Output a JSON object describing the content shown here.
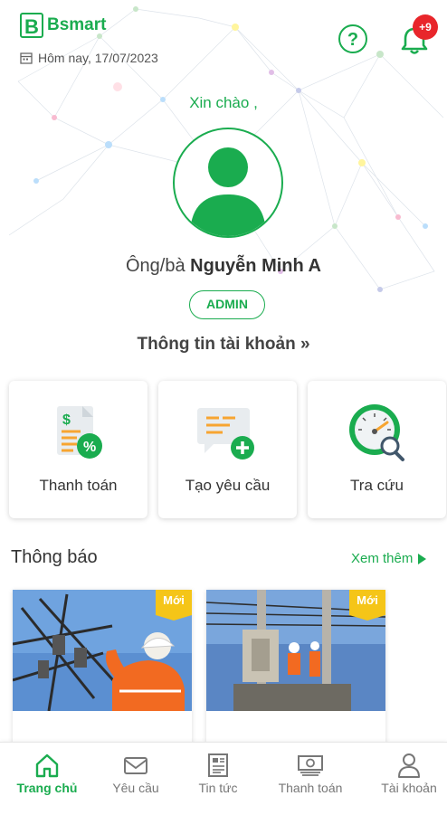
{
  "brand": {
    "logo_letter": "B",
    "name": "Bsmart"
  },
  "header": {
    "date_text": "Hôm nay, 17/07/2023",
    "notification_count": "+9",
    "icons": {
      "help": "help-circle-icon",
      "bell": "bell-icon",
      "calendar": "calendar-icon"
    }
  },
  "profile": {
    "greeting": "Xin chào ,",
    "salutation": "Ông/bà",
    "name": "Nguyễn Minh A",
    "role": "ADMIN",
    "account_link": "Thông tin tài khoản »"
  },
  "actions": [
    {
      "label": "Thanh toán",
      "icon": "payment-bill-icon"
    },
    {
      "label": "Tạo yêu cầu",
      "icon": "create-request-icon"
    },
    {
      "label": "Tra cứu",
      "icon": "meter-lookup-icon"
    }
  ],
  "notifications": {
    "title": "Thông báo",
    "see_more": "Xem thêm",
    "items": [
      {
        "badge": "Mới"
      },
      {
        "badge": "Mới"
      }
    ]
  },
  "bottom_nav": [
    {
      "label": "Trang chủ",
      "icon": "home-icon",
      "active": true
    },
    {
      "label": "Yêu cầu",
      "icon": "mail-icon",
      "active": false
    },
    {
      "label": "Tin tức",
      "icon": "newspaper-icon",
      "active": false
    },
    {
      "label": "Thanh toán",
      "icon": "cash-icon",
      "active": false
    },
    {
      "label": "Tài khoản",
      "icon": "user-icon",
      "active": false
    }
  ],
  "colors": {
    "primary": "#1aac4f",
    "badge_red": "#e8262b",
    "new_badge": "#f5c518"
  }
}
